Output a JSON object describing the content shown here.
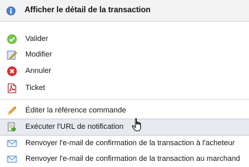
{
  "menu": {
    "header": {
      "label": "Afficher le détail de la transaction",
      "icon": "info-icon"
    },
    "group1": [
      {
        "label": "Valider",
        "icon": "check-icon"
      },
      {
        "label": "Modifier",
        "icon": "edit-icon"
      },
      {
        "label": "Annuler",
        "icon": "cancel-icon"
      },
      {
        "label": "Ticket",
        "icon": "pdf-icon"
      }
    ],
    "group2": [
      {
        "label": "Éditer la référence commande",
        "icon": "pencil-icon"
      },
      {
        "label": "Exécuter l'URL de notification",
        "icon": "run-script-icon"
      },
      {
        "label": "Renvoyer l'e-mail de confirmation de la transaction à l'acheteur",
        "icon": "email-icon"
      },
      {
        "label": "Renvoyer l'e-mail de confirmation de la transaction au marchand",
        "icon": "email-icon"
      }
    ]
  }
}
